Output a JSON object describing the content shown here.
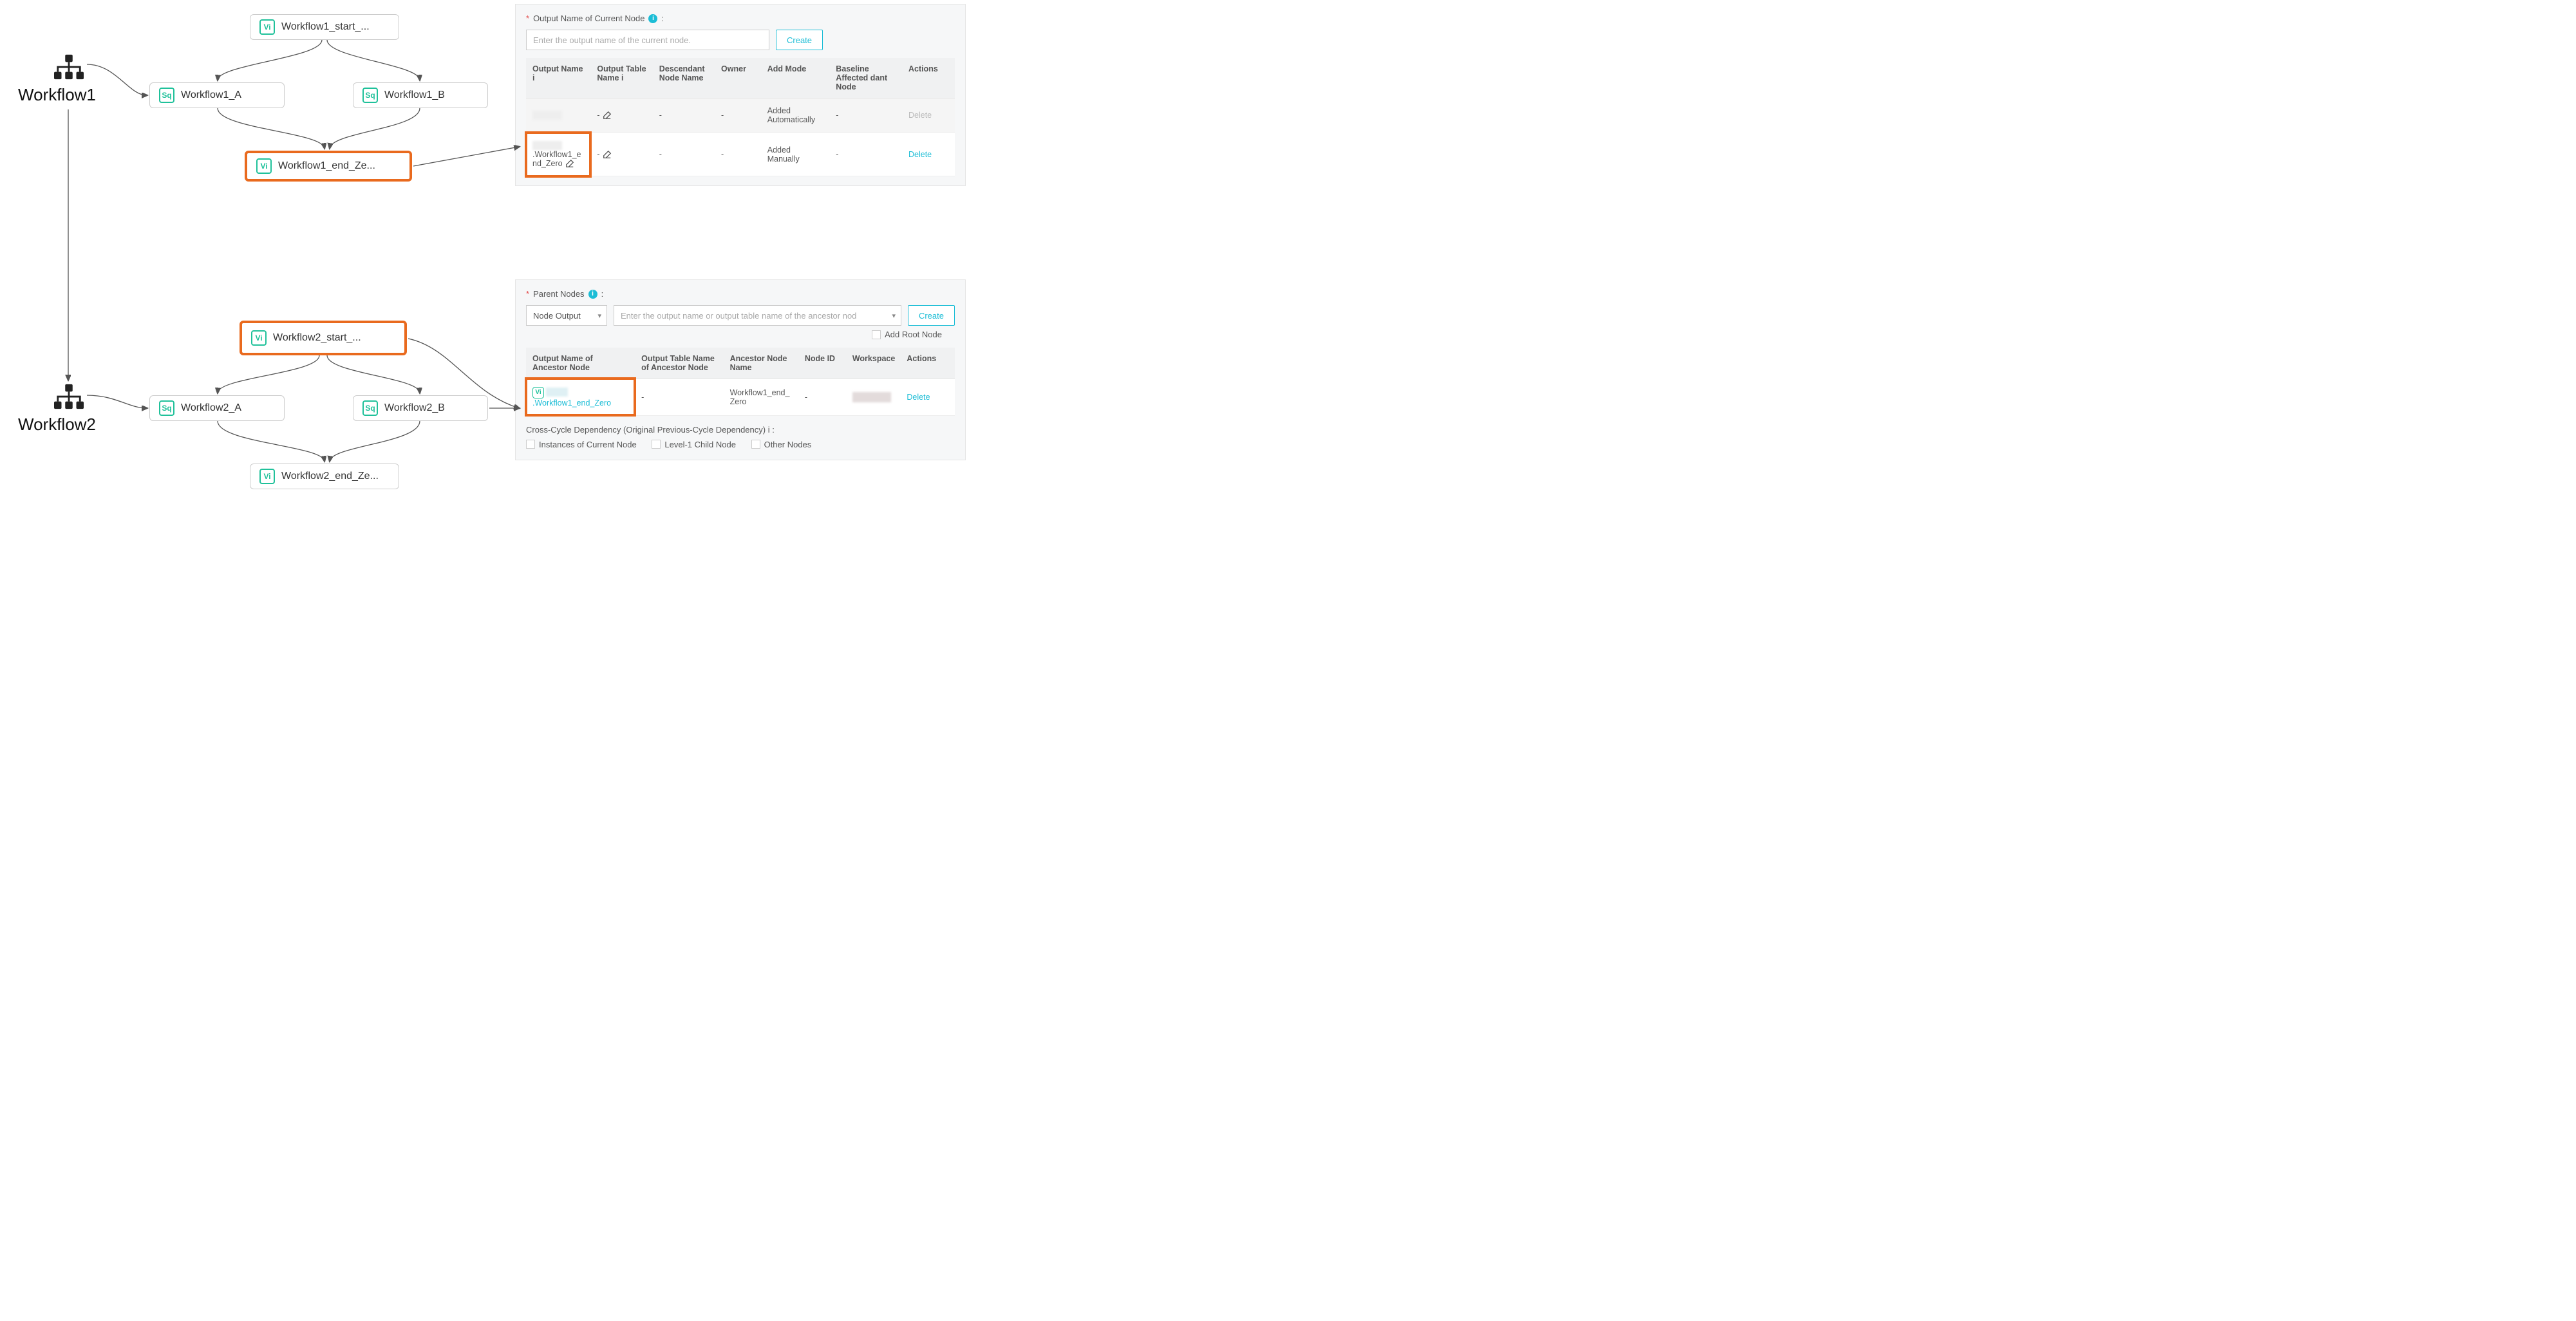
{
  "workflows": {
    "wf1": {
      "label": "Workflow1"
    },
    "wf2": {
      "label": "Workflow2"
    }
  },
  "nodes": {
    "wf1_start": {
      "badge": "Vi",
      "name": "Workflow1_start_..."
    },
    "wf1_a": {
      "badge": "Sq",
      "name": "Workflow1_A"
    },
    "wf1_b": {
      "badge": "Sq",
      "name": "Workflow1_B"
    },
    "wf1_end": {
      "badge": "Vi",
      "name": "Workflow1_end_Ze..."
    },
    "wf2_start": {
      "badge": "Vi",
      "name": "Workflow2_start_..."
    },
    "wf2_a": {
      "badge": "Sq",
      "name": "Workflow2_A"
    },
    "wf2_b": {
      "badge": "Sq",
      "name": "Workflow2_B"
    },
    "wf2_end": {
      "badge": "Vi",
      "name": "Workflow2_end_Ze..."
    }
  },
  "panel_output": {
    "title": "Output Name of Current Node",
    "placeholder": "Enter the output name of the current node.",
    "create_btn": "Create",
    "headers": {
      "out_name": "Output Name",
      "out_table": "Output Table Name",
      "desc_node": "Descendant Node Name",
      "owner": "Owner",
      "add_mode": "Add Mode",
      "baseline": "Baseline Affected dant Node",
      "actions": "Actions"
    },
    "rows": [
      {
        "out_name": "",
        "out_table": "-",
        "desc_node": "-",
        "owner": "-",
        "add_mode": "Added Automatically",
        "baseline": "-",
        "action": "Delete",
        "action_disabled": true
      },
      {
        "out_name_suffix": ".Workflow1_end_Zero",
        "out_table": "-",
        "desc_node": "-",
        "owner": "-",
        "add_mode": "Added Manually",
        "baseline": "-",
        "action": "Delete",
        "action_disabled": false
      }
    ]
  },
  "panel_parent": {
    "title": "Parent Nodes",
    "select_value": "Node Output",
    "placeholder": "Enter the output name or output table name of the ancestor nod",
    "create_btn": "Create",
    "add_root": "Add Root Node",
    "headers": {
      "out_name": "Output Name of Ancestor Node",
      "out_table": "Output Table Name of Ancestor Node",
      "anc_name": "Ancestor Node Name",
      "node_id": "Node ID",
      "workspace": "Workspace",
      "actions": "Actions"
    },
    "row": {
      "out_name_suffix": ".Workflow1_end_Zero",
      "out_table": "-",
      "anc_name": "Workflow1_end_Zero",
      "node_id": "-",
      "action": "Delete"
    },
    "cross_cycle": {
      "title": "Cross-Cycle Dependency (Original Previous-Cycle Dependency)",
      "opt1": "Instances of Current Node",
      "opt2": "Level-1 Child Node",
      "opt3": "Other Nodes"
    }
  }
}
